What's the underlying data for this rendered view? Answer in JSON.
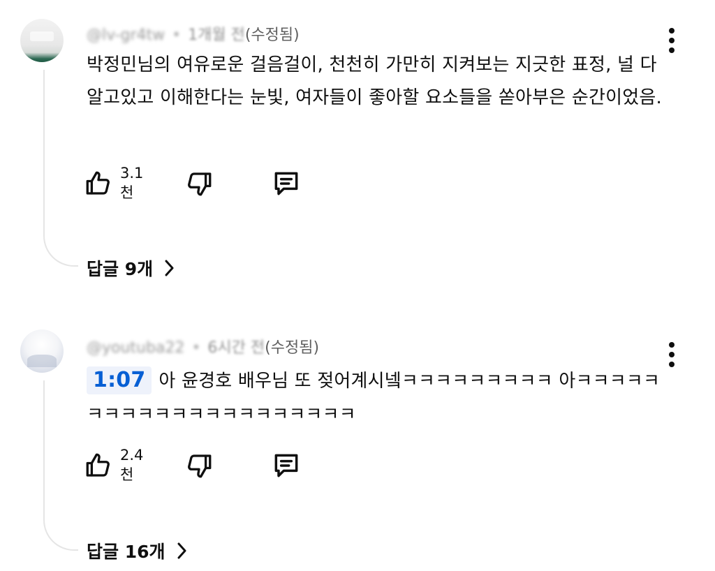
{
  "comments": [
    {
      "author_handle": "@lv-gr4tw",
      "time": "1개월 전",
      "edited": "(수정됨)",
      "text": "박정민님의 여유로운 걸음걸이, 천천히 가만히 지켜보는 지긋한 표정, 널 다 알고있고 이해한다는 눈빛, 여자들이 좋아할 요소들을 쏟아부은 순간이었음.",
      "timestamp_link": "",
      "likes": "3.1천",
      "replies_label": "답글 9개"
    },
    {
      "author_handle": "@youtuba22",
      "time": "6시간 전",
      "edited": "(수정됨)",
      "timestamp_link": "1:07",
      "text": "아 윤경호 배우님 또 젖어계시넼ㅋㅋㅋㅋㅋㅋㅋㅋㅋ 아ㅋㅋㅋㅋㅋㅋㅋㅋㅋㅋㅋㅋㅋㅋㅋㅋㅋㅋㅋㅋㅋ",
      "likes": "2.4천",
      "replies_label": "답글 16개"
    }
  ],
  "icons": {
    "like": "thumbs-up-icon",
    "dislike": "thumbs-down-icon",
    "reply": "comment-reply-icon",
    "more": "more-vert-icon",
    "chevron": "chevron-right-icon"
  },
  "colors": {
    "link": "#065fd4",
    "text": "#0f0f0f",
    "meta": "#606060",
    "thread_line": "#e5e5e5"
  }
}
